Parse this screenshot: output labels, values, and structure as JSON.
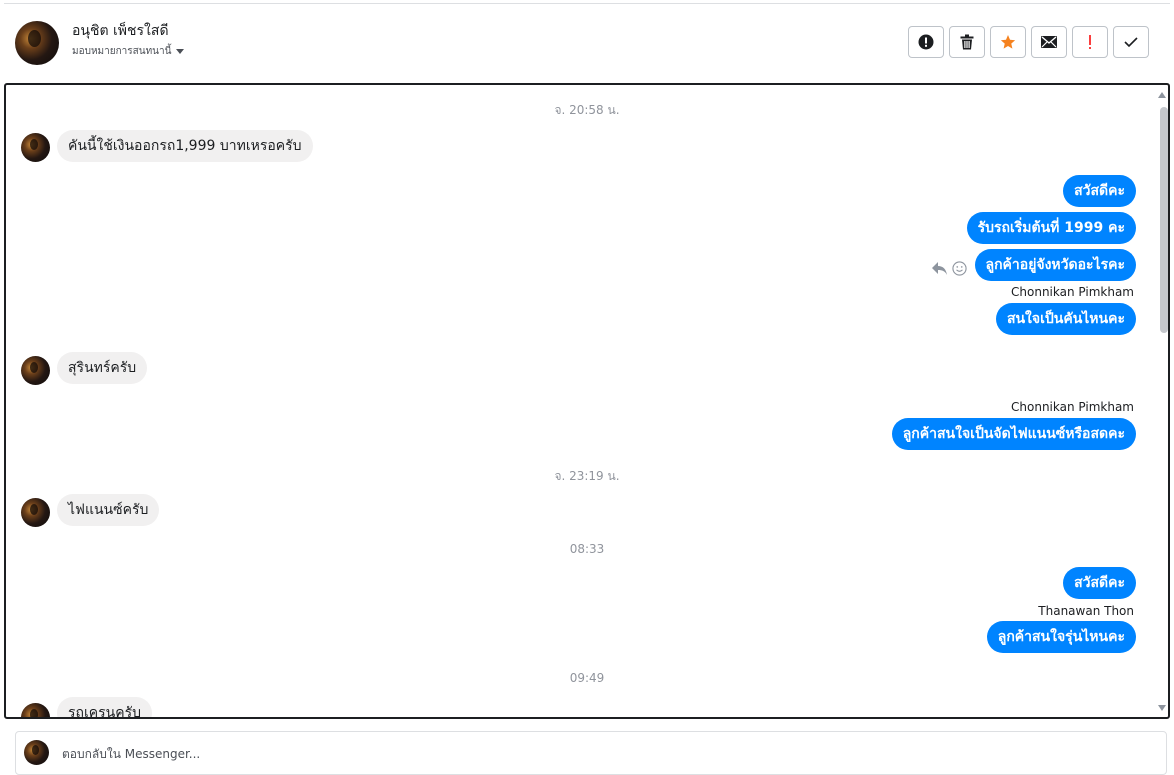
{
  "header": {
    "name": "อนุชิต เพ็ชรใสดี",
    "assign_label": "มอบหมายการสนทนานี้",
    "actions": [
      {
        "icon": "alert-circle-icon",
        "label": "!"
      },
      {
        "icon": "trash-icon"
      },
      {
        "icon": "star-icon",
        "color": "#f5821f"
      },
      {
        "icon": "envelope-icon"
      },
      {
        "icon": "exclamation-icon",
        "label": "!",
        "color": "#fa3e3e"
      },
      {
        "icon": "check-icon"
      }
    ]
  },
  "conversation": {
    "timestamps": [
      "จ. 20:58 น.",
      "จ. 23:19 น.",
      "08:33",
      "09:49"
    ],
    "incoming": [
      "คันนี้ใช้เงินออกรถ1,999 บาทเหรอครับ",
      "สุรินทร์ครับ",
      "ไฟแนนซ์ครับ",
      "รถเครนครับ"
    ],
    "outgoing": [
      "สวัสดีคะ",
      "รับรถเริ่มต้นที่ 1999 คะ",
      "ลูกค้าอยู่จังหวัดอะไรคะ",
      "สนใจเป็นคันไหนคะ",
      "ลูกค้าสนใจเป็นจัดไฟแนนซ์หรือสดคะ",
      "สวัสดีคะ",
      "ลูกค้าสนใจรุ่นไหนคะ"
    ],
    "senders": [
      "Chonnikan Pimkham",
      "Chonnikan Pimkham",
      "Thanawan Thon"
    ]
  },
  "reply": {
    "placeholder": "ตอบกลับใน Messenger..."
  },
  "colors": {
    "brand_blue": "#0084ff",
    "incoming_bubble": "#f1f0f0",
    "star": "#f5821f",
    "important": "#fa3e3e"
  }
}
